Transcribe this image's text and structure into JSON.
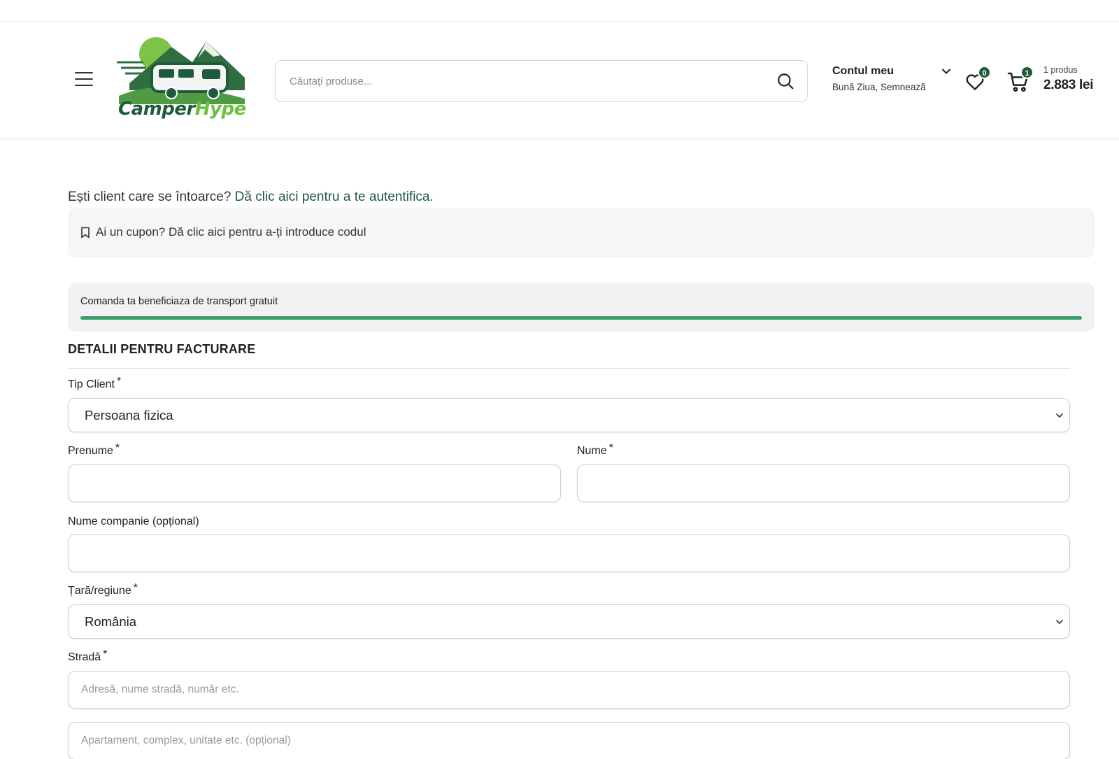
{
  "header": {
    "logo": {
      "part1": "Camper",
      "part2": "Hype"
    },
    "search": {
      "placeholder": "Căutați produse..."
    },
    "account": {
      "title": "Contul meu",
      "greeting": "Bună Ziua, Semnează"
    },
    "wishlist": {
      "count": "0"
    },
    "cart": {
      "count": "1",
      "items_label": "1 produs",
      "total": "2.883 lei"
    }
  },
  "notices": {
    "returning_text": "Ești client care se întoarce?",
    "returning_link": "Dă clic aici pentru a te autentifica.",
    "coupon_text": "Ai un cupon? Dă clic aici pentru a-ți introduce codul"
  },
  "shipping": {
    "message": "Comanda ta beneficiaza de transport gratuit",
    "progress": 1.0
  },
  "billing": {
    "title": "DETALII PENTRU FACTURARE",
    "client_type": {
      "label": "Tip Client",
      "required": "*",
      "value": "Persoana fizica"
    },
    "first_name": {
      "label": "Prenume",
      "required": "*",
      "value": ""
    },
    "last_name": {
      "label": "Nume",
      "required": "*",
      "value": ""
    },
    "company": {
      "label": "Nume companie (opțional)",
      "value": ""
    },
    "country": {
      "label": "Țară/regiune",
      "required": "*",
      "value": "România"
    },
    "street": {
      "label": "Stradă",
      "required": "*",
      "placeholder1": "Adresă, nume stradă, număr etc.",
      "placeholder2": "Apartament, complex, unitate etc. (opțional)"
    }
  },
  "colors": {
    "brand_dark": "#1f5a3a",
    "brand_light": "#6cbf3f",
    "progress": "#3c9e6b"
  }
}
